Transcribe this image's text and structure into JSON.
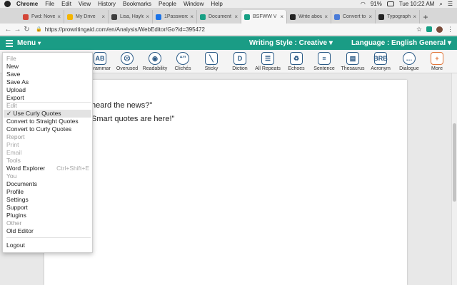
{
  "macbar": {
    "app": "Chrome",
    "menus": [
      "File",
      "Edit",
      "View",
      "History",
      "Bookmarks",
      "People",
      "Window",
      "Help"
    ],
    "battery": "91%",
    "clock": "Tue 10:22 AM"
  },
  "tabs": [
    {
      "title": "Fwd: Nove",
      "color": "#d44638"
    },
    {
      "title": "My Drive",
      "color": "#f4b400"
    },
    {
      "title": "Lisa, Hayle",
      "color": "#3c3c3c"
    },
    {
      "title": "1Password",
      "color": "#1a73e8"
    },
    {
      "title": "Document",
      "color": "#18a085"
    },
    {
      "title": "BSFWW V",
      "color": "#18a085"
    },
    {
      "title": "Write abou",
      "color": "#222222"
    },
    {
      "title": "Convert to",
      "color": "#4a7bd8"
    },
    {
      "title": "Typograph",
      "color": "#222222"
    }
  ],
  "address": {
    "url": "https://prowritingaid.com/en/Analysis/WebEditor/Go?id=395472"
  },
  "appbar": {
    "menu_label": "Menu",
    "writing_style": "Writing Style : Creative",
    "language": "Language : English General"
  },
  "toolbar": {
    "tools": [
      "Grammar",
      "Overused",
      "Readability",
      "Clichés",
      "Sticky",
      "Diction",
      "All Repeats",
      "Echoes",
      "Sentence",
      "Thesaurus",
      "Acronym",
      "Dialogue",
      "More"
    ]
  },
  "editor": {
    "line1": "heard the news?\"",
    "line2": "Smart quotes are here!\""
  },
  "menu": {
    "file_head": "File",
    "new": "New",
    "save": "Save",
    "save_as": "Save As",
    "upload": "Upload",
    "export": "Export",
    "edit_head": "Edit",
    "use_curly": "✓ Use Curly Quotes",
    "convert_straight": "Convert to Straight Quotes",
    "convert_curly": "Convert to Curly Quotes",
    "report_head": "Report",
    "print": "Print",
    "email": "Email",
    "tools_head": "Tools",
    "word_explorer": "Word Explorer",
    "word_explorer_shortcut": "Ctrl+Shift+E",
    "you_head": "You",
    "documents": "Documents",
    "profile": "Profile",
    "settings": "Settings",
    "support": "Support",
    "plugins": "Plugins",
    "other_head": "Other",
    "old_editor": "Old Editor",
    "logout": "Logout"
  }
}
